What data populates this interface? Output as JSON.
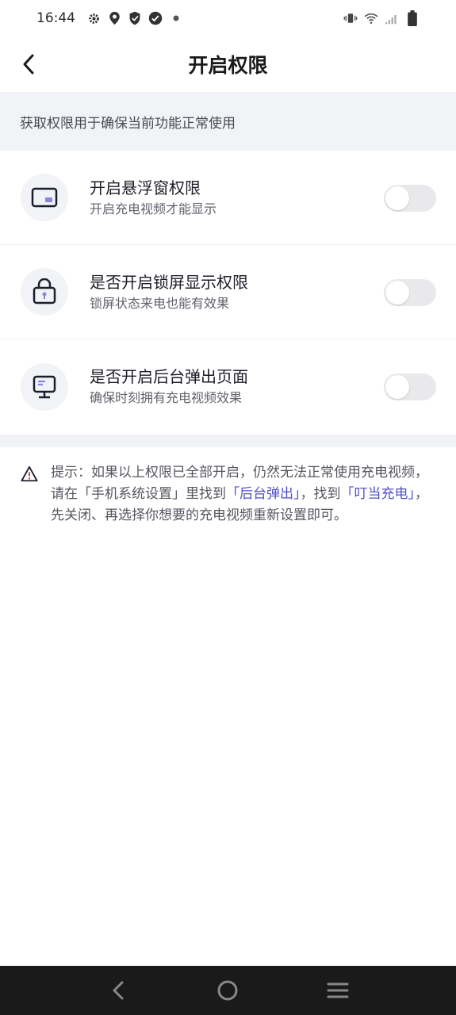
{
  "status_bar": {
    "time": "16:44",
    "icons_left": [
      "gear-icon",
      "location-icon",
      "shield-icon",
      "check-badge-icon",
      "dot-icon"
    ],
    "icons_right": [
      "vibrate-icon",
      "wifi-icon",
      "signal-icon",
      "battery-icon"
    ]
  },
  "header": {
    "title": "开启权限"
  },
  "banner": {
    "text": "获取权限用于确保当前功能正常使用"
  },
  "permissions": [
    {
      "title": "开启悬浮窗权限",
      "subtitle": "开启充电视频才能显示",
      "icon": "floating-window-icon",
      "enabled": false
    },
    {
      "title": "是否开启锁屏显示权限",
      "subtitle": "锁屏状态来电也能有效果",
      "icon": "lock-screen-icon",
      "enabled": false
    },
    {
      "title": "是否开启后台弹出页面",
      "subtitle": "确保时刻拥有充电视频效果",
      "icon": "monitor-icon",
      "enabled": false
    }
  ],
  "tip": {
    "prefix": "提示：如果以上权限已全部开启，仍然无法正常使用充电视频，请在",
    "settings": "「手机系统设置」",
    "middle1": "里找到",
    "link1": "「后台弹出」",
    "middle2": "，找到",
    "link2": "「叮当充电」",
    "suffix": "，先关闭、再选择你想要的充电视频重新设置即可。"
  },
  "colors": {
    "accent_link": "#4f4fc8",
    "banner_bg": "#f2f3f7",
    "toggle_off": "#e9e9ec",
    "nav_bg": "#1a1a1a"
  }
}
